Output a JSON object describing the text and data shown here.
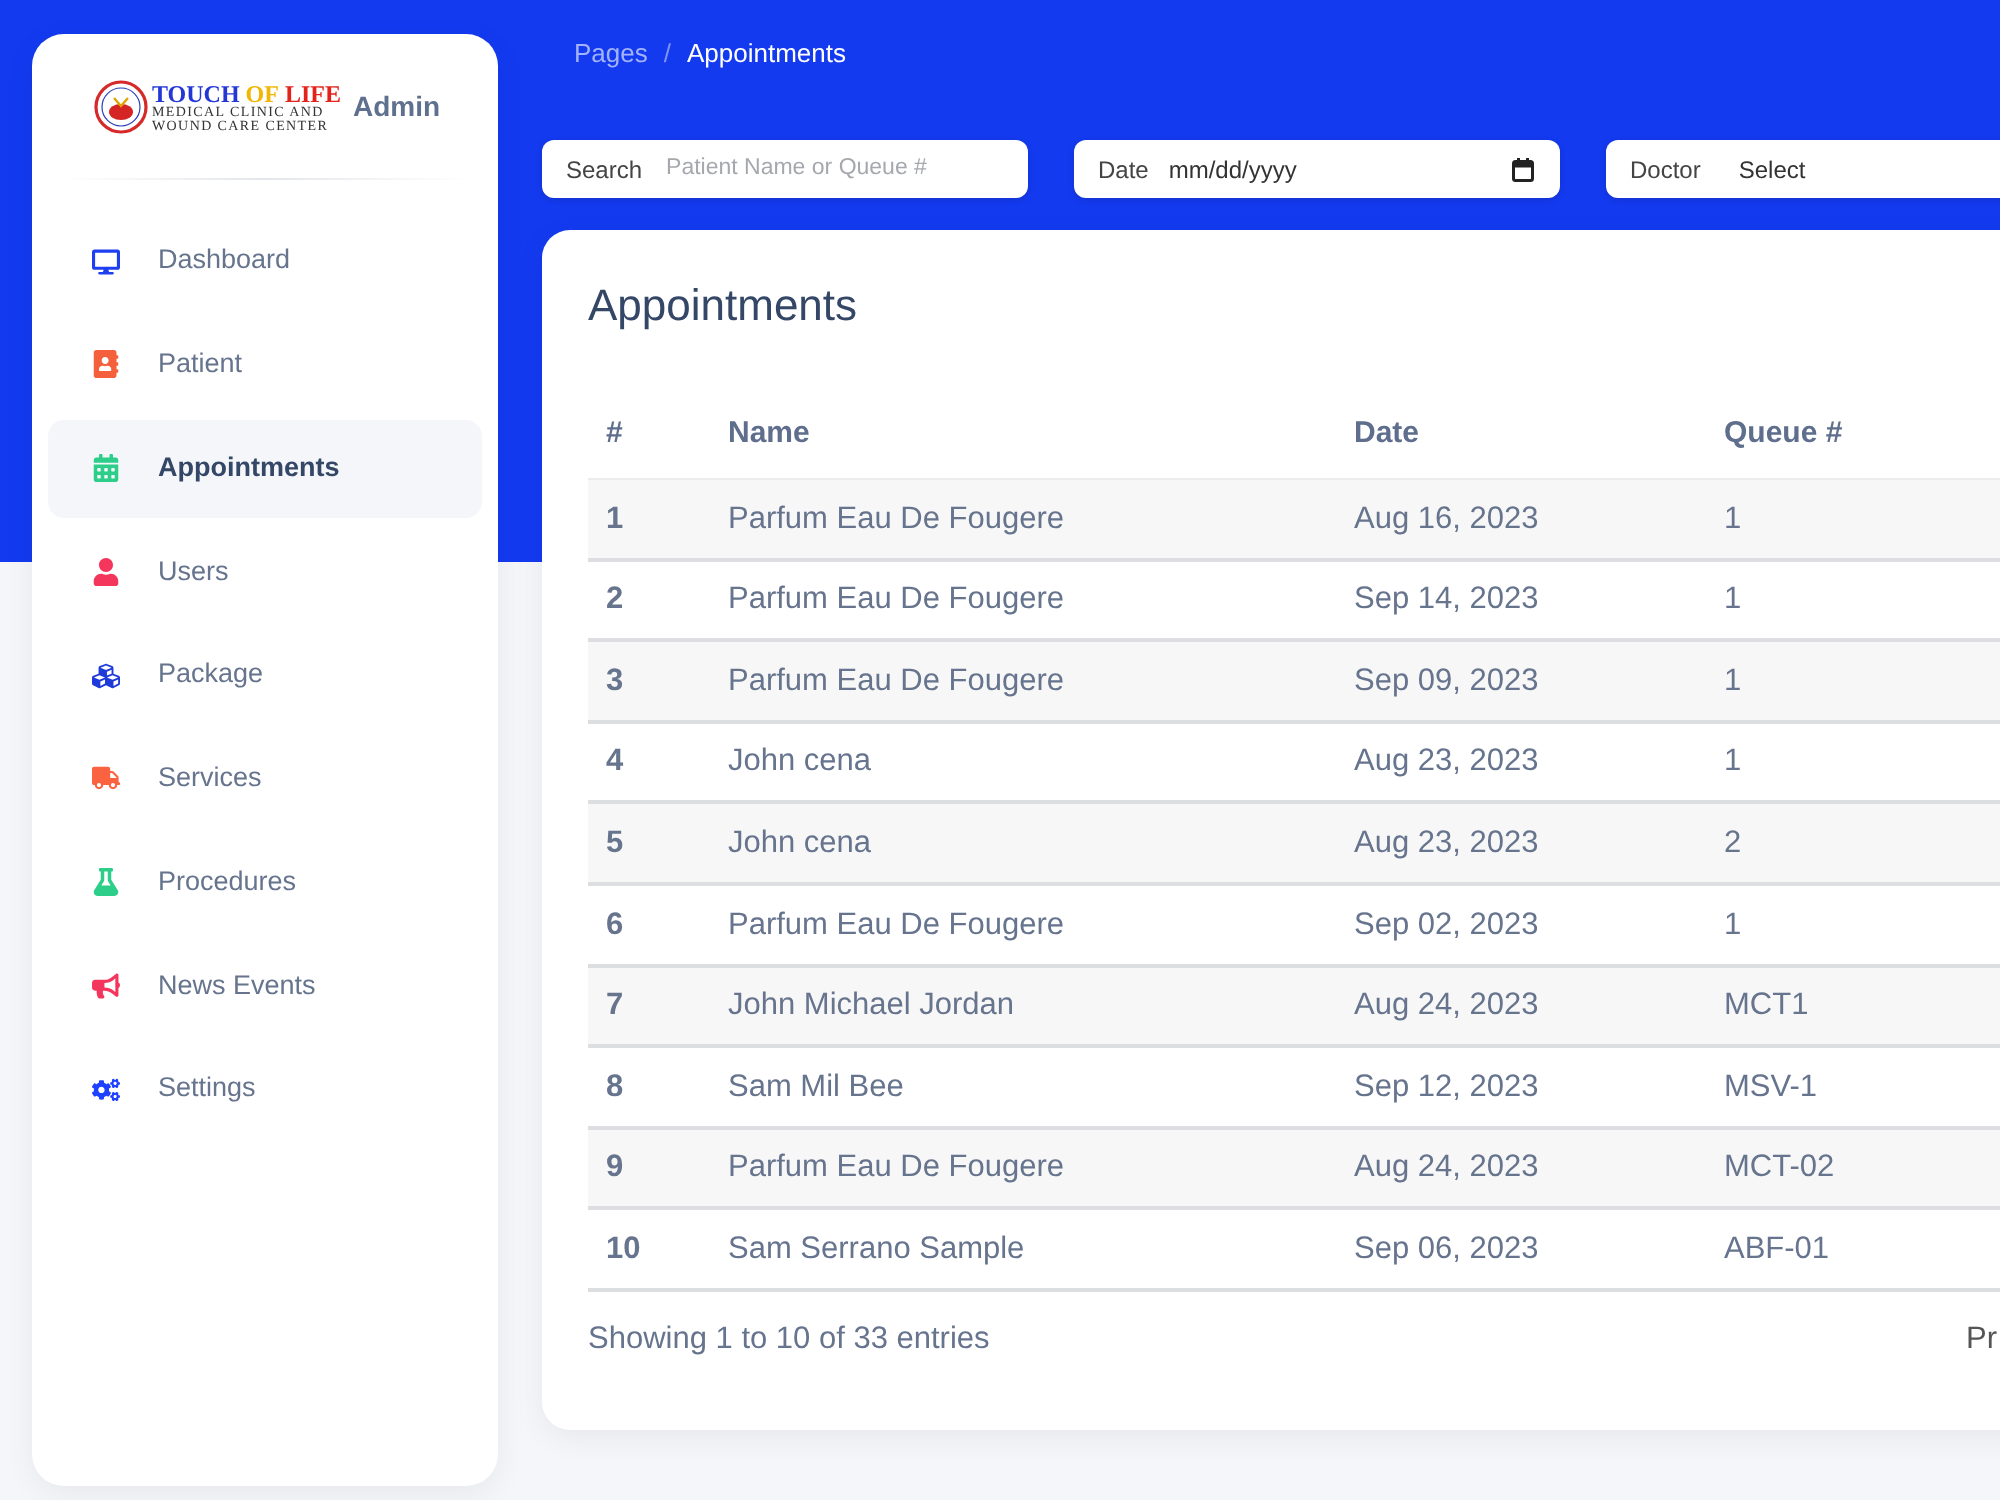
{
  "sidebar": {
    "logo": {
      "title": [
        {
          "text": "TOUCH",
          "color": "#2437d6"
        },
        {
          "text": "OF",
          "color": "#f2b705"
        },
        {
          "text": "LIFE",
          "color": "#e3231b"
        }
      ],
      "subtitle": [
        "MEDICAL CLINIC AND",
        "WOUND CARE CENTER"
      ]
    },
    "role": "Admin",
    "items": [
      {
        "label": "Dashboard",
        "color": "#1e3ff0",
        "selected": false
      },
      {
        "label": "Patient",
        "color": "#f5603c",
        "selected": false
      },
      {
        "label": "Appointments",
        "color": "#2dce89",
        "selected": true
      },
      {
        "label": "Users",
        "color": "#f5365c",
        "selected": false
      },
      {
        "label": "Package",
        "color": "#1e3ad8",
        "selected": false
      },
      {
        "label": "Services",
        "color": "#fb6340",
        "selected": false
      },
      {
        "label": "Procedures",
        "color": "#2dce89",
        "selected": false
      },
      {
        "label": "News Events",
        "color": "#f5365c",
        "selected": false
      },
      {
        "label": "Settings",
        "color": "#1e40ff",
        "selected": false
      }
    ]
  },
  "breadcrumb": {
    "separator": "/",
    "items": [
      {
        "label": "Pages",
        "selected": false
      },
      {
        "label": "Appointments",
        "selected": true
      }
    ]
  },
  "filters": [
    {
      "kind": "text",
      "label": "Search",
      "placeholder": "Patient Name or Queue #"
    },
    {
      "kind": "date",
      "label": "Date",
      "placeholder": "mm/dd/yyyy"
    },
    {
      "kind": "select",
      "label": "Doctor",
      "value": "Select"
    }
  ],
  "card": {
    "title": "Appointments"
  },
  "table": {
    "columns": [
      "#",
      "Name",
      "Date",
      "Queue #"
    ],
    "rows": [
      [
        "1",
        "Parfum Eau De Fougere",
        "Aug 16, 2023",
        "1"
      ],
      [
        "2",
        "Parfum Eau De Fougere",
        "Sep 14, 2023",
        "1"
      ],
      [
        "3",
        "Parfum Eau De Fougere",
        "Sep 09, 2023",
        "1"
      ],
      [
        "4",
        "John cena",
        "Aug 23, 2023",
        "1"
      ],
      [
        "5",
        "John cena",
        "Aug 23, 2023",
        "2"
      ],
      [
        "6",
        "Parfum Eau De Fougere",
        "Sep 02, 2023",
        "1"
      ],
      [
        "7",
        "John Michael Jordan",
        "Aug 24, 2023",
        "MCT1"
      ],
      [
        "8",
        "Sam Mil Bee",
        "Sep 12, 2023",
        "MSV-1"
      ],
      [
        "9",
        "Parfum Eau De Fougere",
        "Aug 24, 2023",
        "MCT-02"
      ],
      [
        "10",
        "Sam Serrano Sample",
        "Sep 06, 2023",
        "ABF-01"
      ]
    ]
  },
  "footer": {
    "info": "Showing 1 to 10 of 33 entries",
    "pagination_text": "Pr"
  }
}
